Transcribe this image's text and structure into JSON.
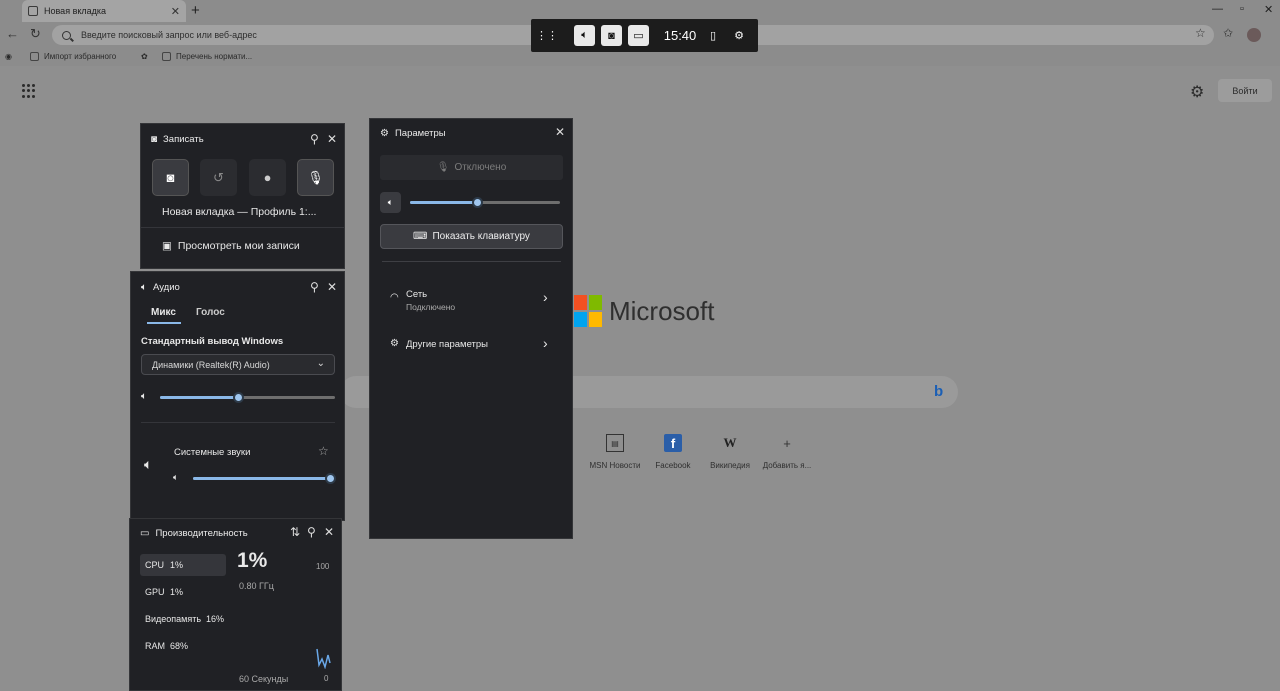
{
  "browser": {
    "tab_title": "Новая вкладка",
    "address_placeholder": "Введите поисковый запрос или веб-адрес",
    "bookmarks": [
      "Импорт избранного",
      "Перечень нормати..."
    ],
    "signin_label": "Войти",
    "brand": "Microsoft",
    "quick_links": [
      "MSN Новости",
      "Facebook",
      "Википедия",
      "Добавить я..."
    ]
  },
  "gamebar": {
    "time": "15:40"
  },
  "capture": {
    "title": "Записать",
    "target": "Новая вкладка — Профиль 1:...",
    "view_recordings": "Просмотреть мои записи"
  },
  "audio": {
    "title": "Аудио",
    "tabs": [
      "Микс",
      "Голос"
    ],
    "output_label": "Стандартный вывод Windows",
    "device": "Динамики (Realtek(R) Audio)",
    "main_volume": 0.45,
    "system_sounds_label": "Системные звуки",
    "system_sounds_volume": 1.0
  },
  "settings": {
    "title": "Параметры",
    "mic_status": "Отключено",
    "volume": 0.45,
    "keyboard_button": "Показать клавиатуру",
    "network_label": "Сеть",
    "network_status": "Подключено",
    "other_settings": "Другие параметры"
  },
  "performance": {
    "title": "Производительность",
    "metrics": [
      {
        "name": "CPU",
        "value": "1%"
      },
      {
        "name": "GPU",
        "value": "1%"
      },
      {
        "name": "Видеопамять",
        "value": "16%"
      },
      {
        "name": "RAM",
        "value": "68%"
      }
    ],
    "big_value": "1%",
    "freq": "0.80 ГГц",
    "axis_max": "100",
    "axis_min": "0",
    "time_span": "60 Секунды"
  },
  "colors": {
    "accent": "#8ab8e8",
    "panel_bg": "#202125",
    "ms_red": "#f25022",
    "ms_green": "#7fba00",
    "ms_blue": "#00a4ef",
    "ms_yellow": "#ffb900"
  }
}
